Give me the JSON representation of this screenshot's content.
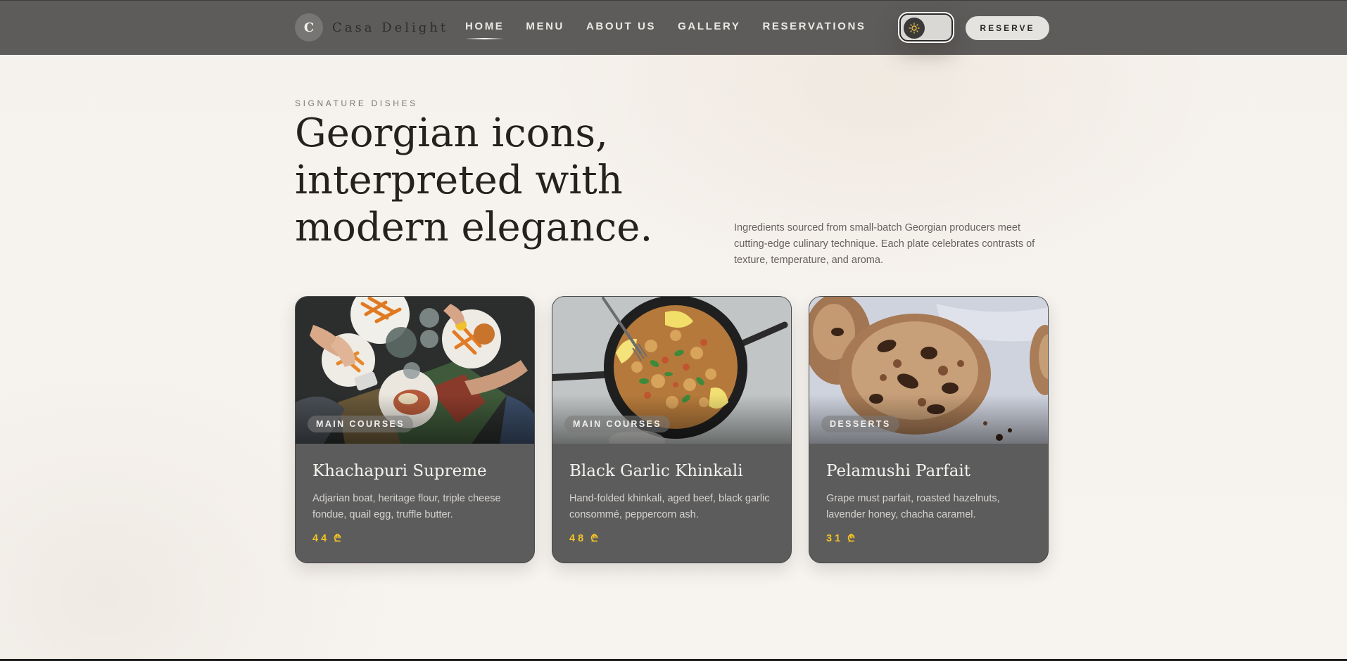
{
  "brand": {
    "initial": "C",
    "name": "Casa Delight"
  },
  "nav": {
    "links": [
      "HOME",
      "MENU",
      "ABOUT US",
      "GALLERY",
      "RESERVATIONS"
    ],
    "active": "HOME",
    "reserve_label": "RESERVE",
    "theme_icon": "sun-icon"
  },
  "hero": {
    "eyebrow": "SIGNATURE DISHES",
    "headline_lines": [
      "Georgian icons,",
      "interpreted with",
      "modern elegance."
    ],
    "intro": "Ingredients sourced from small-batch Georgian producers meet cutting-edge culinary technique. Each plate celebrates contrasts of texture, temperature, and aroma."
  },
  "dishes": [
    {
      "category": "MAIN COURSES",
      "title": "Khachapuri Supreme",
      "description": "Adjarian boat, heritage flour, triple cheese fondue, quail egg, truffle butter.",
      "price": "44",
      "currency": "₾",
      "image": "table-spread-photo"
    },
    {
      "category": "MAIN COURSES",
      "title": "Black Garlic Khinkali",
      "description": "Hand-folded khinkali, aged beef, black garlic consommé, peppercorn ash.",
      "price": "48",
      "currency": "₾",
      "image": "rice-pan-photo"
    },
    {
      "category": "DESSERTS",
      "title": "Pelamushi Parfait",
      "description": "Grape must parfait, roasted hazelnuts, lavender honey, chacha caramel.",
      "price": "31",
      "currency": "₾",
      "image": "cookies-photo"
    }
  ],
  "colors": {
    "nav_bg": "#5d5c5b",
    "page_bg": "#f6f3ef",
    "card_bg": "#5c5c5c",
    "price_accent": "#f4c324"
  }
}
